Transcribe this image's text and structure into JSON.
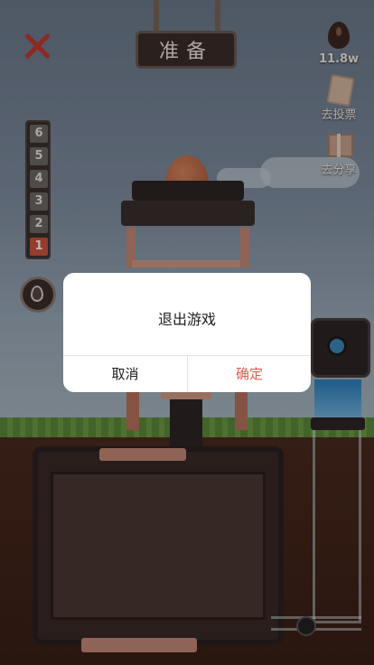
{
  "top_bar": {
    "status_label": "准备",
    "drops_value": "11.8w",
    "ticket_label": "去投票",
    "share_label": "去分享"
  },
  "levels": [
    "6",
    "5",
    "4",
    "3",
    "2",
    "1"
  ],
  "active_level": "1",
  "dialog": {
    "title": "退出游戏",
    "cancel_label": "取消",
    "confirm_label": "确定"
  },
  "colors": {
    "accent_red": "#e35b4e",
    "close_red": "#c23b2e",
    "water_blue": "#2b7fbf"
  },
  "icons": [
    "close-icon",
    "drop-icon",
    "ticket-icon",
    "gift-icon",
    "drop-button-icon"
  ]
}
